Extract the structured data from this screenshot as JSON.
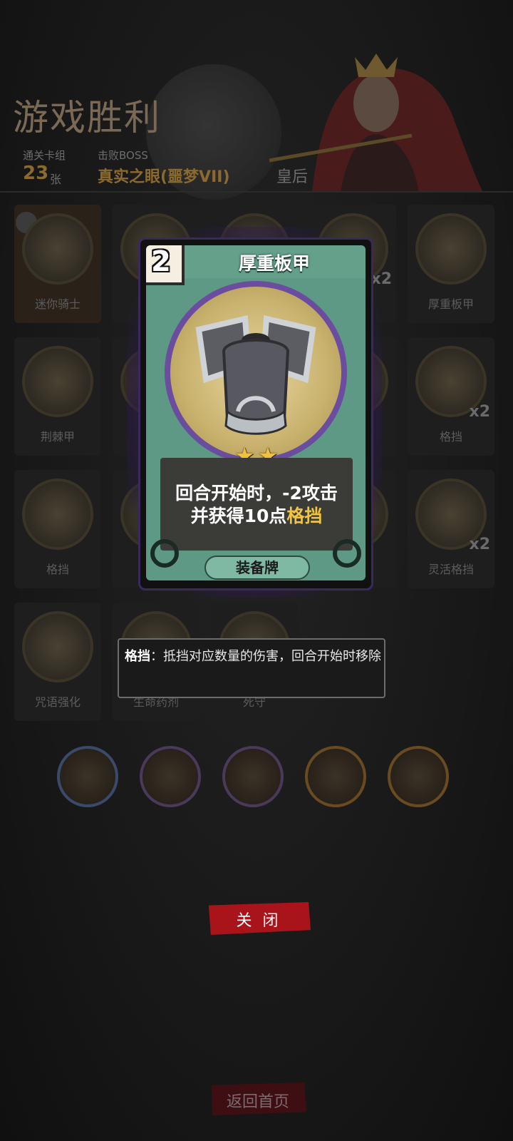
{
  "header": {
    "title": "游戏胜利",
    "deck_label": "通关卡组",
    "deck_count": "23",
    "deck_unit": "张",
    "boss_label": "击败BOSS",
    "boss_name": "真实之眼(噩梦VII)",
    "boss_title": "皇后"
  },
  "cards": [
    {
      "name": "迷你骑士",
      "count": ""
    },
    {
      "name": "",
      "count": ""
    },
    {
      "name": "",
      "count": ""
    },
    {
      "name": "",
      "count": "x2"
    },
    {
      "name": "厚重板甲",
      "count": ""
    },
    {
      "name": "荆棘甲",
      "count": ""
    },
    {
      "name": "",
      "count": ""
    },
    {
      "name": "",
      "count": ""
    },
    {
      "name": "",
      "count": ""
    },
    {
      "name": "格挡",
      "count": "x2"
    },
    {
      "name": "格挡",
      "count": ""
    },
    {
      "name": "",
      "count": ""
    },
    {
      "name": "",
      "count": ""
    },
    {
      "name": "",
      "count": ""
    },
    {
      "name": "灵活格挡",
      "count": "x2"
    },
    {
      "name": "咒语强化",
      "count": ""
    },
    {
      "name": "生命药剂",
      "count": ""
    },
    {
      "name": "死守",
      "count": ""
    }
  ],
  "popup_card": {
    "cost": "2",
    "title": "厚重板甲",
    "stars": "★★",
    "desc_line1": "回合开始时，-2攻击",
    "desc_line2_prefix": "并获得10点",
    "desc_keyword": "格挡",
    "type": "装备牌"
  },
  "tooltip": {
    "keyword": "格挡",
    "text": "：抵挡对应数量的伤害，回合开始时移除"
  },
  "buttons": {
    "close": "关 闭",
    "home": "返回首页"
  },
  "colors": {
    "card_green": "#5e9985",
    "keyword_gold": "#f1c443",
    "close_red": "#a8141a"
  }
}
